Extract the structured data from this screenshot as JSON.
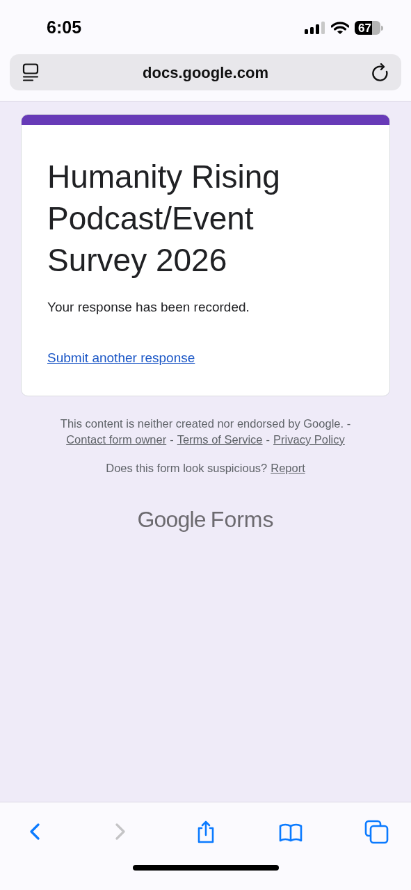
{
  "status_bar": {
    "time": "6:05",
    "battery": "67"
  },
  "address_bar": {
    "url": "docs.google.com"
  },
  "form": {
    "title": "Humanity Rising Podcast/Event Survey 2026",
    "message": "Your response has been recorded.",
    "link": "Submit another response"
  },
  "footer": {
    "disclaimer": "This content is neither created nor endorsed by Google. -",
    "separator": "-",
    "links": [
      "Contact form owner",
      "Terms of Service",
      "Privacy Policy"
    ],
    "question": "Does this form look suspicious?",
    "report_link": "Report",
    "logo_brand": "Google",
    "logo_product": "Forms"
  },
  "toolbar": [
    {
      "kind": "back",
      "disabled": false
    },
    {
      "kind": "forward",
      "disabled": true
    },
    {
      "kind": "share",
      "disabled": false
    },
    {
      "kind": "bookmarks",
      "disabled": false
    },
    {
      "kind": "tabs",
      "disabled": false
    }
  ]
}
